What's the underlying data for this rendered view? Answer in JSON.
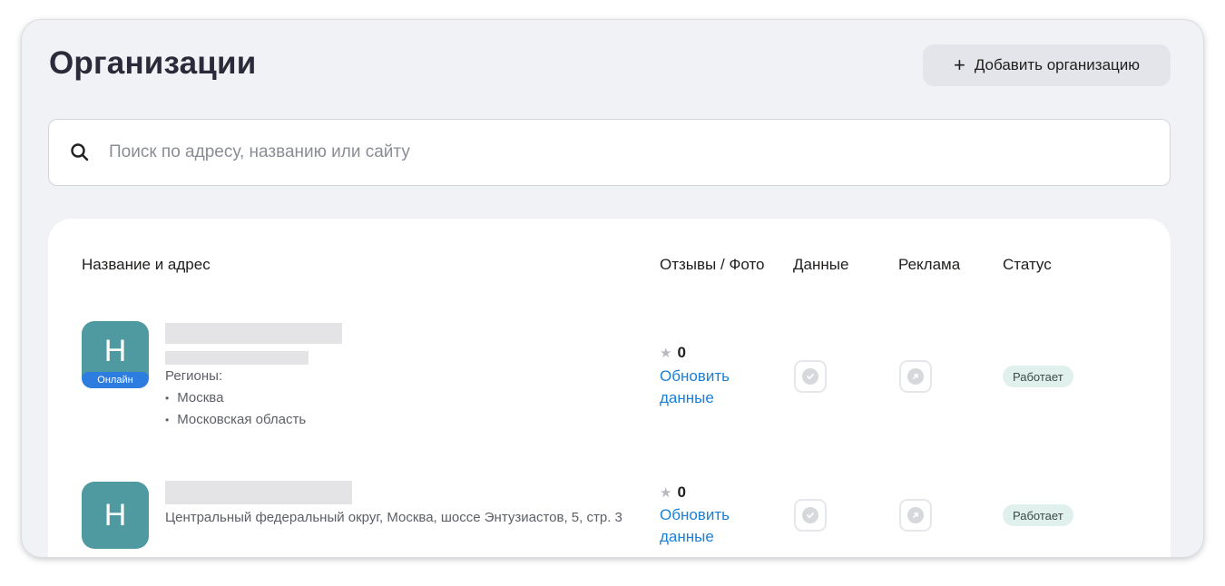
{
  "header": {
    "title": "Организации",
    "add_button_label": "Добавить организацию",
    "add_button_icon": "plus-icon"
  },
  "search": {
    "icon": "search-icon",
    "placeholder": "Поиск по адресу, названию или сайту"
  },
  "table": {
    "columns": [
      "Название и адрес",
      "Отзывы / Фото",
      "Данные",
      "Реклама",
      "Статус"
    ],
    "rows": [
      {
        "avatar_letter": "Н",
        "avatar_badge": "Онлайн",
        "regions_label": "Регионы:",
        "regions": [
          "Москва",
          "Московская область"
        ],
        "rating": "0",
        "update_link": "Обновить данные",
        "status": "Работает"
      },
      {
        "avatar_letter": "Н",
        "address": "Центральный федеральный округ, Москва, шоссе Энтузиастов, 5, стр. 3",
        "rating": "0",
        "update_link": "Обновить данные",
        "status": "Работает"
      }
    ]
  },
  "colors": {
    "accent_link": "#1a7fd8",
    "avatar_bg": "#4f9aa1",
    "status_badge_bg": "#dff0ed"
  }
}
